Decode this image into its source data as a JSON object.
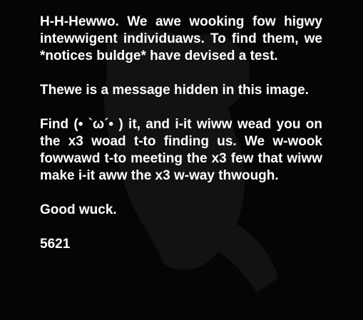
{
  "message": {
    "paragraph_1": "H-H-Hewwo. We awe wooking fow higwy intewwigent individuaws. To find them, we *notices buldge* have devised a test.",
    "paragraph_2": "Thewe is a message hidden in this image.",
    "paragraph_3": "Find (• `ω´• ) it, and i-it wiww wead you on the x3 woad t-to finding us. We w-wook fowwawd t-to meeting the x3 few that wiww make i-it aww the x3 w-way thwough.",
    "signoff": "Good wuck.",
    "code": "5621"
  },
  "colors": {
    "background": "#050505",
    "text": "#ffffff",
    "figure": "#141414"
  }
}
